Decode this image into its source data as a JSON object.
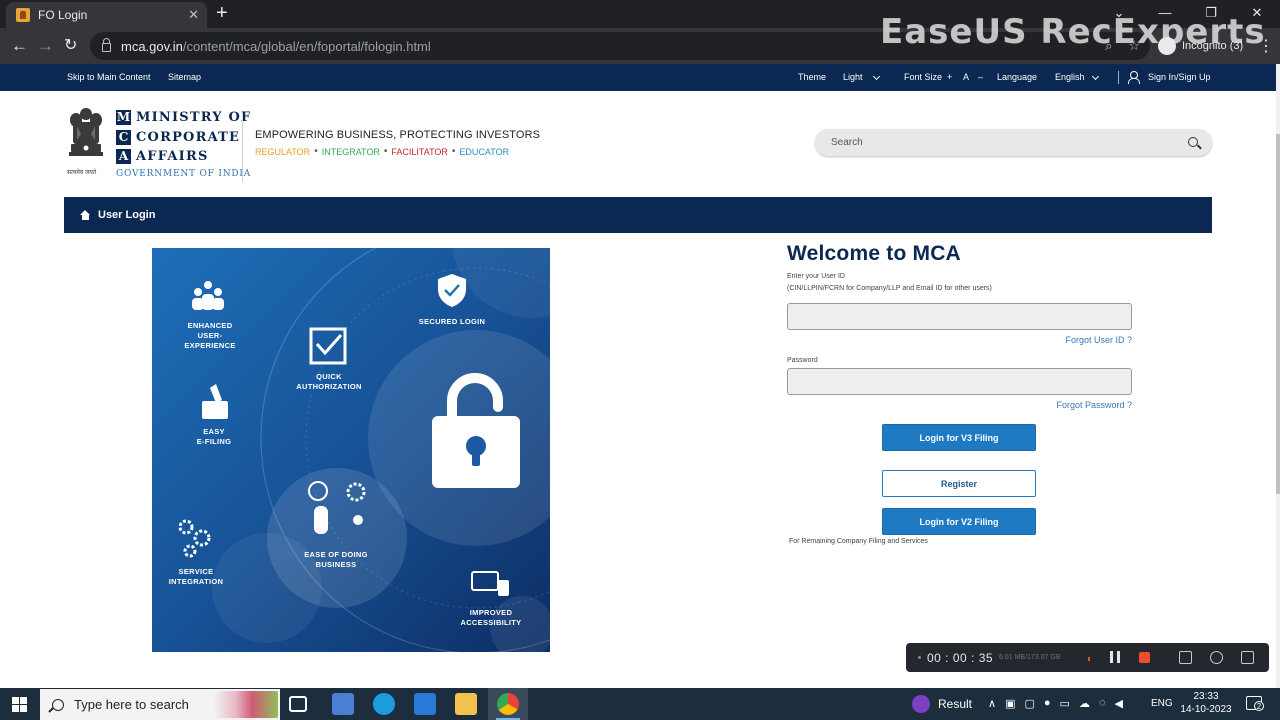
{
  "browser": {
    "tab_title": "FO Login",
    "tab_close": "✕",
    "new_tab": "+",
    "url_domain": "mca.gov.in",
    "url_path": "/content/mca/global/en/foportal/fologin.html",
    "incognito_label": "Incognito (3)",
    "window_controls": [
      "⌄",
      "—",
      "❐",
      "✕"
    ]
  },
  "watermark": "EaseUS RecExperts",
  "utility_bar": {
    "skip_link": "Skip to Main Content",
    "sitemap": "Sitemap",
    "theme_label": "Theme",
    "theme_value": "Light",
    "font_size_label": "Font Size",
    "font_plus": "+",
    "font_a": "A",
    "font_minus": "–",
    "language_label": "Language",
    "language_value": "English",
    "sign_in": "Sign In/Sign Up"
  },
  "header": {
    "brand_letters": [
      "M",
      "C",
      "A"
    ],
    "brand_words": [
      "MINISTRY OF",
      "CORPORATE",
      "AFFAIRS"
    ],
    "emblem_caption": "सत्यमेव जयते",
    "government": "GOVERNMENT OF INDIA",
    "tagline": "EMPOWERING BUSINESS, PROTECTING INVESTORS",
    "roles": [
      {
        "label": "REGULATOR",
        "color": "#e8a020"
      },
      {
        "label": "INTEGRATOR",
        "color": "#34a853"
      },
      {
        "label": "FACILITATOR",
        "color": "#c62828"
      },
      {
        "label": "EDUCATOR",
        "color": "#2e8bc0"
      }
    ],
    "role_separator": "•",
    "search_placeholder": "Search"
  },
  "band": {
    "title": "User Login"
  },
  "illustration": {
    "features": [
      "ENHANCED\nUSER-EXPERIENCE",
      "SECURED LOGIN",
      "QUICK\nAUTHORIZATION",
      "EASY\nE-FILING",
      "EASE OF DOING\nBUSINESS",
      "SERVICE\nINTEGRATION",
      "IMPROVED\nACCESSIBILITY"
    ]
  },
  "login": {
    "heading": "Welcome to MCA",
    "userid_hint": "Enter your User ID",
    "userid_subhint": "(CIN/LLPIN/FCRN for Company/LLP and Email ID for other users)",
    "userid_value": "",
    "forgot_userid": "Forgot User ID ?",
    "password_label": "Password",
    "password_value": "",
    "forgot_password": "Forgot Password ?",
    "v3_button": "Login for V3 Filing",
    "register_button": "Register",
    "v2_button": "Login for V2 Filing",
    "v2_note": "For Remaining Company Filing and Services"
  },
  "recorder": {
    "time": "00 : 00 : 35",
    "size": "6.61 MB/173.07 GB"
  },
  "taskbar": {
    "search_placeholder": "Type here to search",
    "result_label": "Result",
    "language": "ENG",
    "time": "23:33",
    "date": "14-10-2023",
    "notification_count": "2"
  }
}
